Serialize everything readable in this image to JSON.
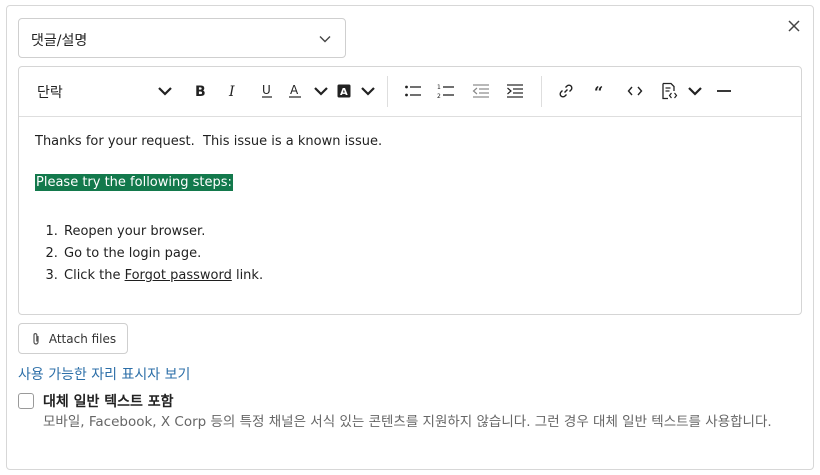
{
  "type_select": {
    "value": "댓글/설명"
  },
  "toolbar": {
    "paragraph_style": "단락",
    "items": [
      "bold",
      "italic",
      "underline",
      "text-color",
      "highlight",
      "bullet-list",
      "numbered-list",
      "outdent",
      "indent",
      "link",
      "quote",
      "code",
      "code-block",
      "more",
      "horizontal-rule"
    ]
  },
  "editor": {
    "line1": "Thanks for your request.  This issue is a known issue.",
    "highlighted": "Please try the following steps:",
    "steps": [
      "Reopen your browser.",
      "Go to the login page.",
      "Click the "
    ],
    "step3_link": "Forgot password",
    "step3_suffix": " link."
  },
  "attach": {
    "label": "Attach files"
  },
  "placeholder_link": "사용 가능한 자리 표시자 보기",
  "plain_text": {
    "label": "대체 일반 텍스트 포함",
    "description": "모바일, Facebook, X Corp 등의 특정 채널은 서식 있는 콘텐츠를 지원하지 않습니다. 그런 경우 대체 일반 텍스트를 사용합니다.",
    "checked": false
  },
  "colors": {
    "highlight_bg": "#13794c",
    "link": "#2d6fa8"
  }
}
